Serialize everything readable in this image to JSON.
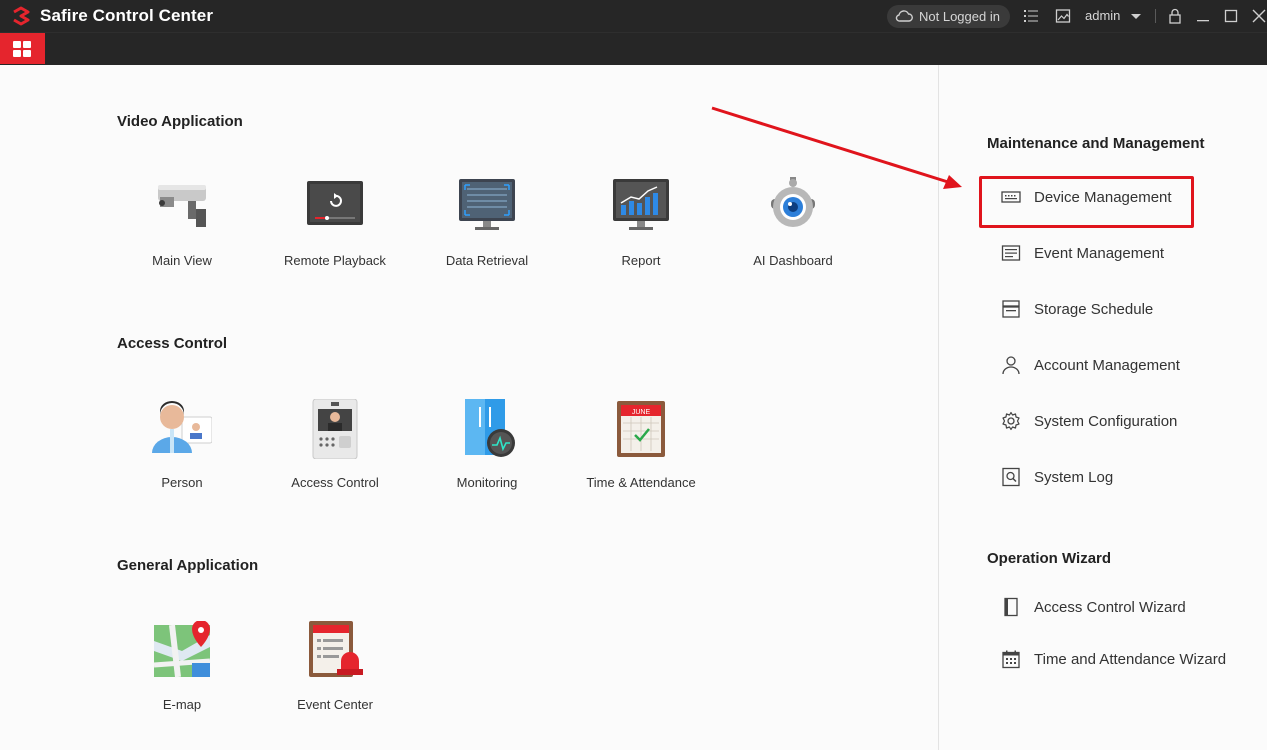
{
  "window": {
    "title": "Safire Control Center",
    "login_status": "Not Logged in",
    "user": "admin"
  },
  "icons": {
    "logo": "safire-logo",
    "cloud": "cloud-icon",
    "menu": "grid-menu-icon"
  },
  "colors": {
    "accent": "#e5252d",
    "titlebar": "#262626",
    "highlight": "#e0141c"
  },
  "sections": {
    "video": {
      "title": "Video Application",
      "items": [
        {
          "label": "Main View"
        },
        {
          "label": "Remote Playback"
        },
        {
          "label": "Data Retrieval"
        },
        {
          "label": "Report"
        },
        {
          "label": "AI Dashboard"
        }
      ]
    },
    "access": {
      "title": "Access Control",
      "items": [
        {
          "label": "Person"
        },
        {
          "label": "Access Control"
        },
        {
          "label": "Monitoring"
        },
        {
          "label": "Time & Attendance"
        }
      ]
    },
    "general": {
      "title": "General Application",
      "items": [
        {
          "label": "E-map"
        },
        {
          "label": "Event Center"
        }
      ]
    }
  },
  "calendar_month": "JUNE",
  "sidebar": {
    "maintenance": {
      "title": "Maintenance and Management",
      "items": [
        {
          "label": "Device Management"
        },
        {
          "label": "Event Management"
        },
        {
          "label": "Storage Schedule"
        },
        {
          "label": "Account Management"
        },
        {
          "label": "System Configuration"
        },
        {
          "label": "System Log"
        }
      ]
    },
    "wizard": {
      "title": "Operation Wizard",
      "items": [
        {
          "label": "Access Control Wizard"
        },
        {
          "label": "Time and Attendance Wizard"
        }
      ]
    }
  }
}
